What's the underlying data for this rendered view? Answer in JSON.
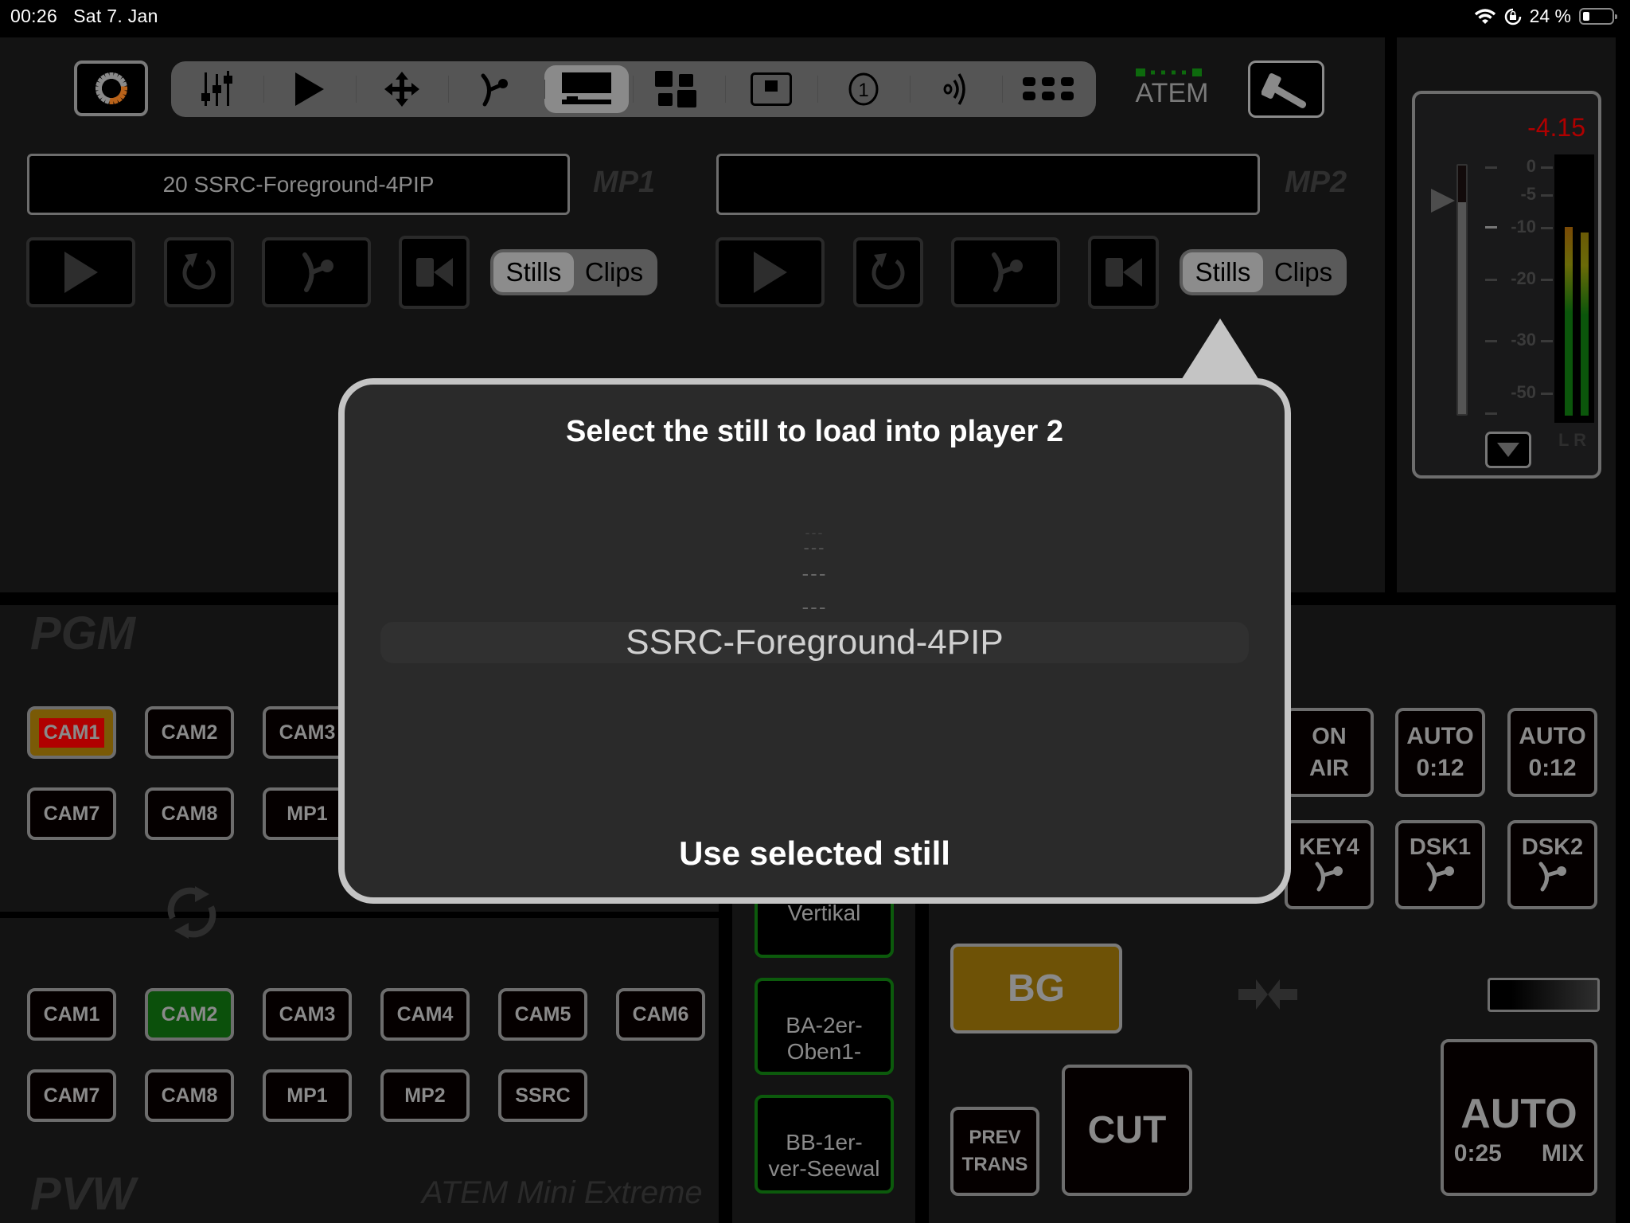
{
  "status_bar": {
    "time": "00:26",
    "date": "Sat 7. Jan",
    "wifi_icon": "wifi-icon",
    "orientation_lock_icon": "orientation-lock-icon",
    "battery_percent": "24 %",
    "battery_level": 0.24
  },
  "toolbar": {
    "logo_icon": "connection-spinner-icon",
    "tools": [
      {
        "name": "mixer-faders",
        "icon": "sliders-icon",
        "active": false
      },
      {
        "name": "media-player",
        "icon": "play-icon",
        "active": false
      },
      {
        "name": "dve-position",
        "icon": "move-arrows-icon",
        "active": false
      },
      {
        "name": "transition",
        "icon": "transition-curve-icon",
        "active": false
      },
      {
        "name": "media-pool",
        "icon": "media-screen-icon",
        "active": true
      },
      {
        "name": "multiview",
        "icon": "grid-layout-icon",
        "active": false
      },
      {
        "name": "supersource",
        "icon": "picture-in-picture-icon",
        "active": false
      },
      {
        "name": "macro-1",
        "icon": "circled-one-icon",
        "active": false
      },
      {
        "name": "audio",
        "icon": "audio-waves-icon",
        "active": false
      },
      {
        "name": "more",
        "icon": "dots-grid-icon",
        "active": false
      }
    ],
    "atem_label": "ATEM",
    "settings_icon": "hammer-icon",
    "indicator_color": "#0d6a0d"
  },
  "media_players": [
    {
      "label": "MP1",
      "loaded_name": "20 SSRC-Foreground-4PIP",
      "segment": {
        "options": [
          "Stills",
          "Clips"
        ],
        "selected": "Stills"
      }
    },
    {
      "label": "MP2",
      "loaded_name": "",
      "segment": {
        "options": [
          "Stills",
          "Clips"
        ],
        "selected": "Stills"
      }
    }
  ],
  "audio": {
    "peak_value": "-4.15",
    "peak_color": "#b00000",
    "scale": [
      "0",
      "-5",
      "-10",
      "-20",
      "-30",
      "-50"
    ],
    "fader_level_db": -6,
    "meter_left_db": -10,
    "meter_right_db": -11,
    "channels": "L R"
  },
  "popover": {
    "title": "Select the still to load into player 2",
    "picker_items": [
      "---",
      "---",
      "---",
      "---"
    ],
    "selected_item": "SSRC-Foreground-4PIP",
    "confirm_label": "Use selected still"
  },
  "program": {
    "label": "PGM",
    "buttons": [
      "CAM1",
      "CAM2",
      "CAM3",
      "CAM7",
      "CAM8",
      "MP1"
    ],
    "active": "CAM1",
    "active_color": "#b00000",
    "border_active_color": "#7a5a06"
  },
  "preview": {
    "label": "PVW",
    "buttons": [
      "CAM1",
      "CAM2",
      "CAM3",
      "CAM4",
      "CAM5",
      "CAM6",
      "CAM7",
      "CAM8",
      "MP1",
      "MP2",
      "SSRC"
    ],
    "active": "CAM2",
    "active_color": "#0b500b",
    "device_name": "ATEM Mini Extreme"
  },
  "macros": [
    "Vertikal",
    "BA-2er-\nOben1-",
    "BB-1er-\nver-Seewal"
  ],
  "keyers": {
    "on_air": "ON\nAIR",
    "auto1": {
      "label": "AUTO",
      "time": "0:12"
    },
    "auto2": {
      "label": "AUTO",
      "time": "0:12"
    },
    "key4": "KEY4",
    "dsk1": "DSK1",
    "dsk2": "DSK2"
  },
  "transition": {
    "bg_label": "BG",
    "prev_trans_label": "PREV\nTRANS",
    "cut_label": "CUT",
    "auto_label": "AUTO",
    "auto_time": "0:25",
    "auto_type": "MIX",
    "bg_color": "#6e5206"
  }
}
